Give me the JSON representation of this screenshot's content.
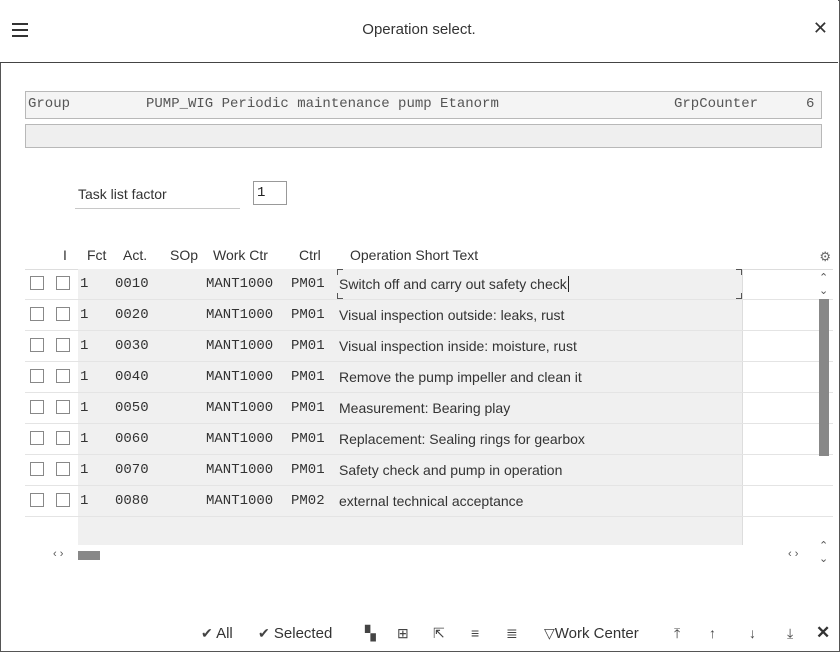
{
  "window": {
    "title": "Operation select.",
    "menu_icon": "hamburger-menu-icon",
    "close_icon": "close-icon"
  },
  "header": {
    "group_label": "Group",
    "group_value": "PUMP_WIG Periodic maintenance pump Etanorm",
    "counter_label": "GrpCounter",
    "counter_value": "6"
  },
  "task_list_factor": {
    "label": "Task list factor",
    "value": "1"
  },
  "table": {
    "columns": [
      "I",
      "Fct",
      "Act.",
      "SOp",
      "Work Ctr",
      "Ctrl",
      "Operation Short Text"
    ],
    "settings_icon": "gear-icon",
    "rows": [
      {
        "fct": "1",
        "act": "0010",
        "sop": "",
        "work_ctr": "MANT1000",
        "ctrl": "PM01",
        "text": "Switch off and carry out safety check"
      },
      {
        "fct": "1",
        "act": "0020",
        "sop": "",
        "work_ctr": "MANT1000",
        "ctrl": "PM01",
        "text": "Visual inspection outside: leaks, rust"
      },
      {
        "fct": "1",
        "act": "0030",
        "sop": "",
        "work_ctr": "MANT1000",
        "ctrl": "PM01",
        "text": "Visual inspection inside: moisture, rust"
      },
      {
        "fct": "1",
        "act": "0040",
        "sop": "",
        "work_ctr": "MANT1000",
        "ctrl": "PM01",
        "text": "Remove the pump impeller and clean it"
      },
      {
        "fct": "1",
        "act": "0050",
        "sop": "",
        "work_ctr": "MANT1000",
        "ctrl": "PM01",
        "text": "Measurement: Bearing play"
      },
      {
        "fct": "1",
        "act": "0060",
        "sop": "",
        "work_ctr": "MANT1000",
        "ctrl": "PM01",
        "text": "Replacement: Sealing rings for gearbox"
      },
      {
        "fct": "1",
        "act": "0070",
        "sop": "",
        "work_ctr": "MANT1000",
        "ctrl": "PM01",
        "text": "Safety check and pump in operation"
      },
      {
        "fct": "1",
        "act": "0080",
        "sop": "",
        "work_ctr": "MANT1000",
        "ctrl": "PM02",
        "text": "external technical acceptance"
      }
    ]
  },
  "toolbar": {
    "all_label": "All",
    "selected_label": "Selected",
    "work_center_label": "Work Center",
    "check_icon": "checkmark-icon",
    "filter_icon": "filter-icon"
  }
}
